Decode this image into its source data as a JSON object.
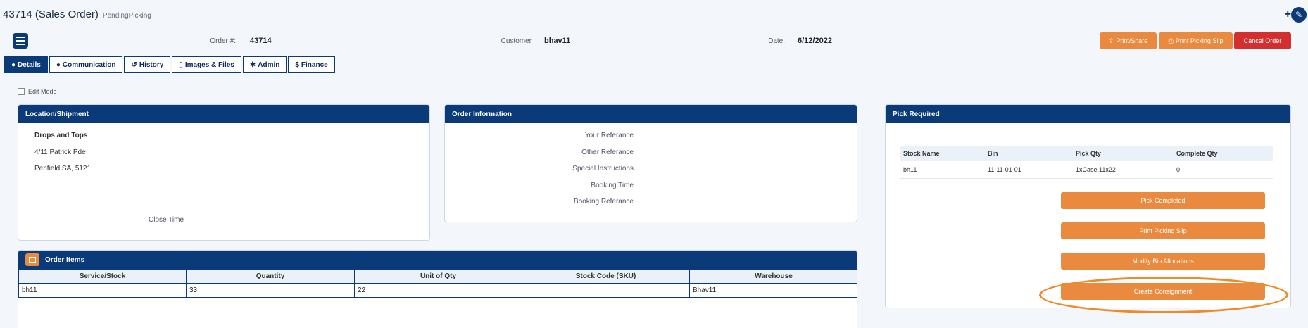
{
  "header": {
    "title": "43714 (Sales Order)",
    "status": "PendingPicking",
    "plus": "+",
    "order_label": "Order #:",
    "order_value": "43714",
    "customer_label": "Customer",
    "customer_value": "bhav11",
    "date_label": "Date:",
    "date_value": "6/12/2022",
    "btn_print_share": "Print/Share",
    "btn_print_picking": "Print Picking Slip",
    "btn_cancel": "Cancel Order"
  },
  "tabs": [
    "Details",
    "Communication",
    "History",
    "Images & Files",
    "Admin",
    "Finance"
  ],
  "edit_mode": "Edit Mode",
  "location": {
    "title": "Location/Shipment",
    "name": "Drops and Tops",
    "address1": "4/11 Patrick Pde",
    "address2": "Penfield SA, 5121",
    "close_time": "Close Time"
  },
  "order_info": {
    "title": "Order Information",
    "labels": [
      "Your Referance",
      "Other Referance",
      "Special Instructions",
      "Booking Time",
      "Booking Referance"
    ]
  },
  "pick": {
    "title": "Pick Required",
    "columns": [
      "Stock Name",
      "Bin",
      "Pick Qty",
      "Complete Qty"
    ],
    "rows": [
      [
        "bh11",
        "11-11-01-01",
        "1xCase,11x22",
        "0"
      ]
    ],
    "buttons": [
      "Pick Completed",
      "Print Picking Slip",
      "Modify Bin Allocations",
      "Create Consignment"
    ]
  },
  "order_items": {
    "title": "Order Items",
    "columns": [
      "Service/Stock",
      "Quantity",
      "Unit of Qty",
      "Stock Code (SKU)",
      "Warehouse"
    ],
    "rows": [
      [
        "bh11",
        "33",
        "22",
        "",
        "Bhav11"
      ]
    ]
  },
  "colors": {
    "brand": "#0b3a78",
    "accent": "#e98a3f",
    "danger": "#d32f2f",
    "highlight": "#f08a28"
  }
}
